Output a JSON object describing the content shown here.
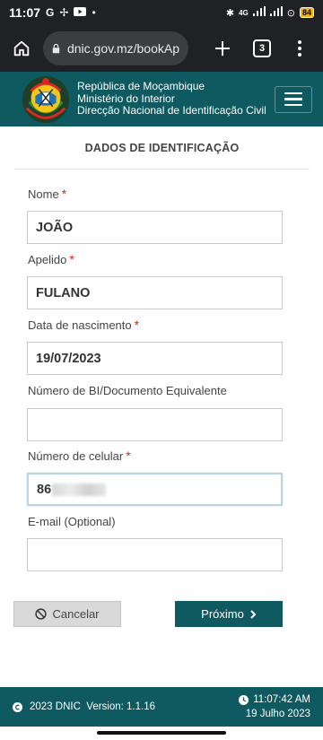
{
  "status_bar": {
    "time": "11:07",
    "network": "4G",
    "battery": "84"
  },
  "browser": {
    "url": "dnic.gov.mz/bookAp",
    "tab_count": "3"
  },
  "header": {
    "line1": "República de Moçambique",
    "line2": "Ministério do Interior",
    "line3": "Direcção Nacional de Identificação Civil"
  },
  "form": {
    "title": "DADOS DE IDENTIFICAÇÃO",
    "fields": [
      {
        "label": "Nome",
        "required": "*",
        "value": "JOÃO"
      },
      {
        "label": "Apelido",
        "required": "*",
        "value": "FULANO"
      },
      {
        "label": "Data de nascimento",
        "required": "*",
        "value": "19/07/2023"
      },
      {
        "label": "Número de BI/Documento Equivalente",
        "value": ""
      },
      {
        "label": "Número de celular",
        "required": "*",
        "value": "86"
      },
      {
        "label": "E-mail (Optional)",
        "value": ""
      }
    ]
  },
  "buttons": {
    "cancel": "Cancelar",
    "next": "Próximo"
  },
  "footer": {
    "copyright": "2023 DNIC  Version: 1.1.16",
    "time": "11:07:42 AM",
    "date": "19 Julho 2023"
  },
  "colors": {
    "brand_teal": "#0f5a60",
    "required_red": "#d9251c"
  }
}
